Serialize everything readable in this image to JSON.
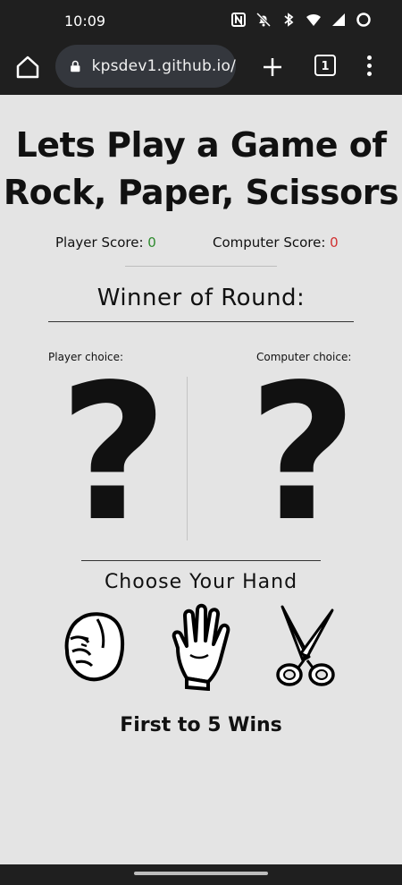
{
  "status_bar": {
    "time": "10:09",
    "icons": [
      "nfc-icon",
      "bell-off-icon",
      "bluetooth-icon",
      "wifi-icon",
      "signal-icon",
      "battery-icon"
    ]
  },
  "browser": {
    "url": "kpsdev1.github.io/",
    "tab_count": "1"
  },
  "game": {
    "title_line1": "Lets Play a Game of",
    "title_line2": "Rock, Paper, Scissors",
    "player_score_label": "Player Score: ",
    "player_score": "0",
    "computer_score_label": "Computer Score: ",
    "computer_score": "0",
    "winner_label": "Winner of Round:",
    "player_choice_label": "Player choice:",
    "computer_choice_label": "Computer choice:",
    "player_choice_symbol": "?",
    "computer_choice_symbol": "?",
    "choose_label": "Choose Your Hand",
    "footer": "First to 5 Wins",
    "hands": [
      "rock-hand-icon",
      "paper-hand-icon",
      "scissors-icon"
    ]
  },
  "colors": {
    "player_score": "#2e8b2e",
    "computer_score": "#d13030",
    "page_bg": "#e4e4e4",
    "chrome_bg": "#1f1f1f"
  }
}
